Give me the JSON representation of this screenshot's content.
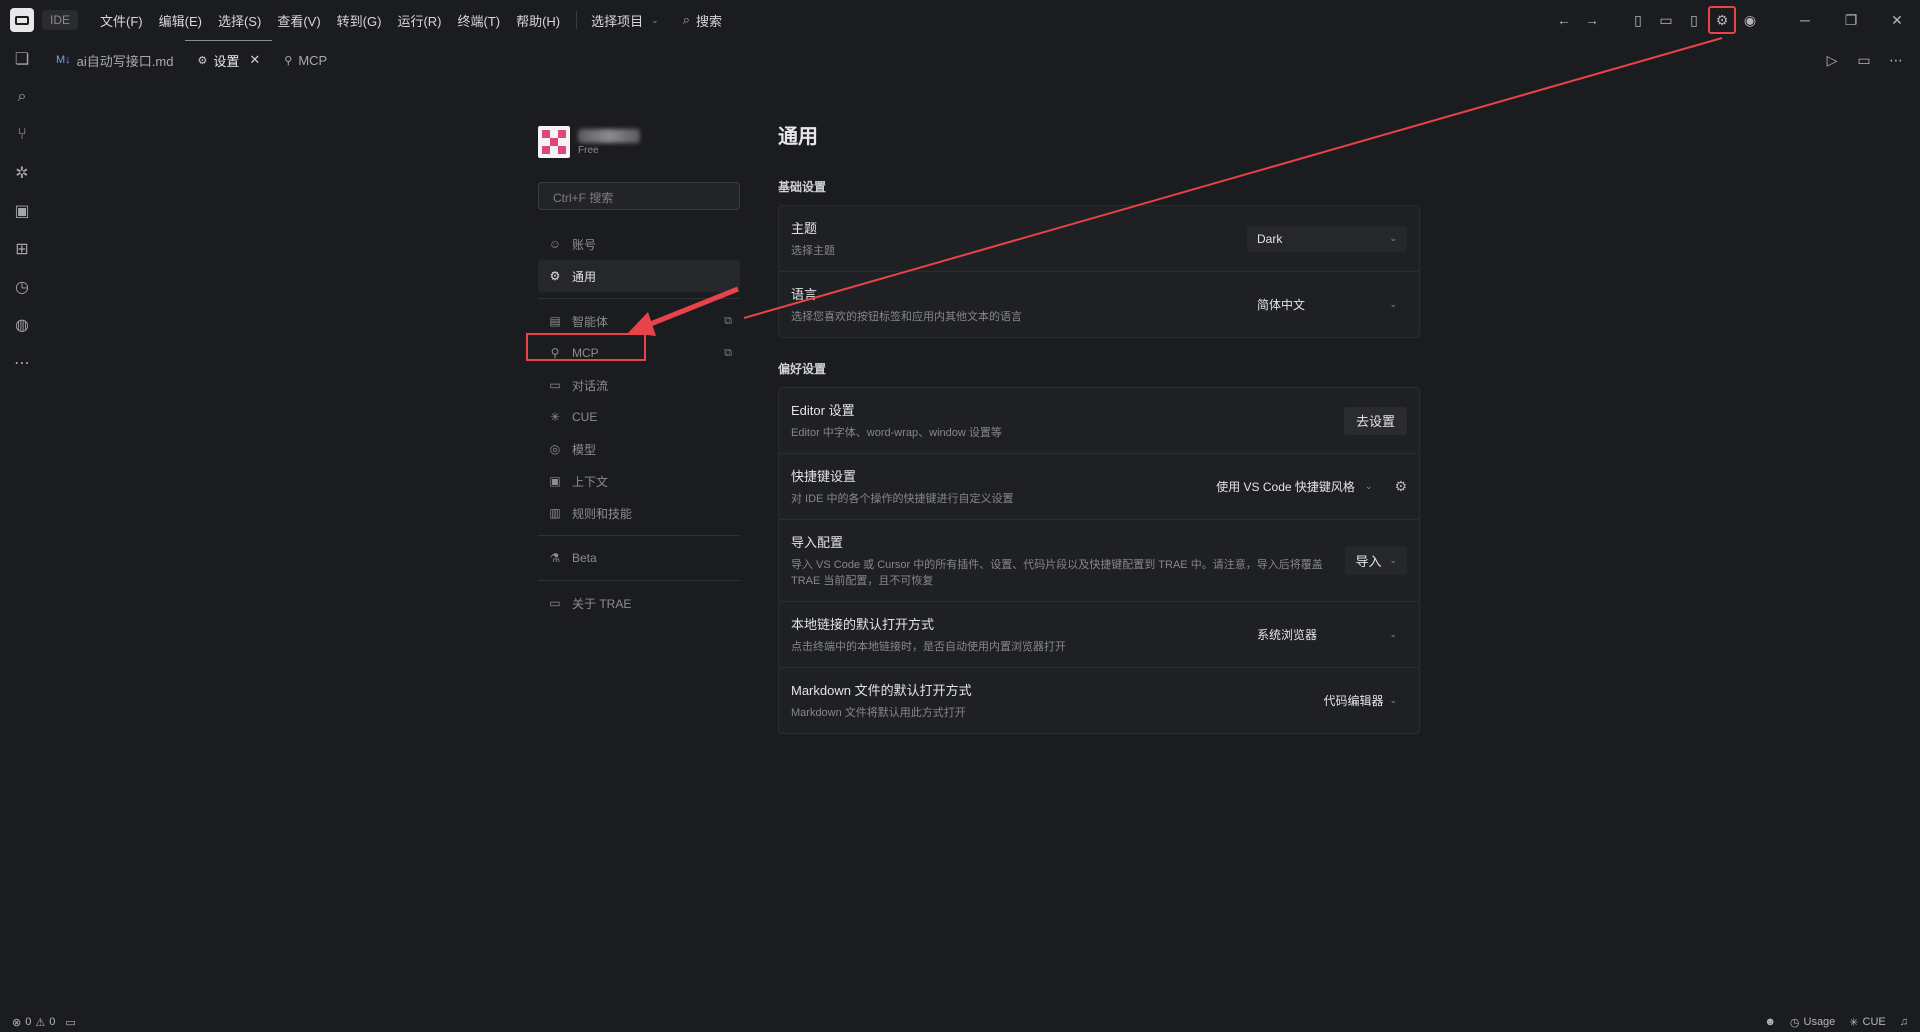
{
  "titlebar": {
    "ide_label": "IDE",
    "menu": [
      "文件(F)",
      "编辑(E)",
      "选择(S)",
      "查看(V)",
      "转到(G)",
      "运行(R)",
      "终端(T)",
      "帮助(H)"
    ],
    "project_select": "选择项目",
    "search_label": "搜索"
  },
  "tabs": [
    {
      "label": "ai自动写接口.md",
      "icon": "markdown-icon"
    },
    {
      "label": "设置",
      "icon": "gear-icon"
    },
    {
      "label": "MCP",
      "icon": "wrench-icon"
    }
  ],
  "settings_nav": {
    "plan": "Free",
    "search_placeholder": "Ctrl+F 搜索",
    "items": {
      "account": "账号",
      "general": "通用",
      "agent": "智能体",
      "mcp": "MCP",
      "chatflow": "对话流",
      "cue": "CUE",
      "models": "模型",
      "context": "上下文",
      "rules": "规则和技能",
      "beta": "Beta",
      "about": "关于 TRAE"
    }
  },
  "content": {
    "title": "通用",
    "basic_section": "基础设置",
    "theme": {
      "title": "主题",
      "desc": "选择主题",
      "value": "Dark"
    },
    "language": {
      "title": "语言",
      "desc": "选择您喜欢的按钮标签和应用内其他文本的语言",
      "value": "简体中文"
    },
    "prefs_section": "偏好设置",
    "editor": {
      "title": "Editor 设置",
      "desc": "Editor 中字体、word-wrap、window 设置等",
      "button": "去设置"
    },
    "shortcut": {
      "title": "快捷键设置",
      "desc": "对 IDE 中的各个操作的快捷键进行自定义设置",
      "value": "使用 VS Code 快捷键风格"
    },
    "import": {
      "title": "导入配置",
      "desc": "导入 VS Code 或 Cursor 中的所有插件、设置、代码片段以及快捷键配置到 TRAE 中。请注意，导入后将覆盖 TRAE 当前配置，且不可恢复",
      "button": "导入"
    },
    "local_link": {
      "title": "本地链接的默认打开方式",
      "desc": "点击终端中的本地链接时，是否自动使用内置浏览器打开",
      "value": "系统浏览器"
    },
    "markdown": {
      "title": "Markdown 文件的默认打开方式",
      "desc": "Markdown 文件将默认用此方式打开",
      "value": "代码编辑器"
    }
  },
  "statusbar": {
    "errors": "0",
    "warnings": "0",
    "usage": "Usage",
    "cue": "CUE"
  },
  "colors": {
    "highlight": "#e8434b",
    "background": "#1b1c1f"
  }
}
